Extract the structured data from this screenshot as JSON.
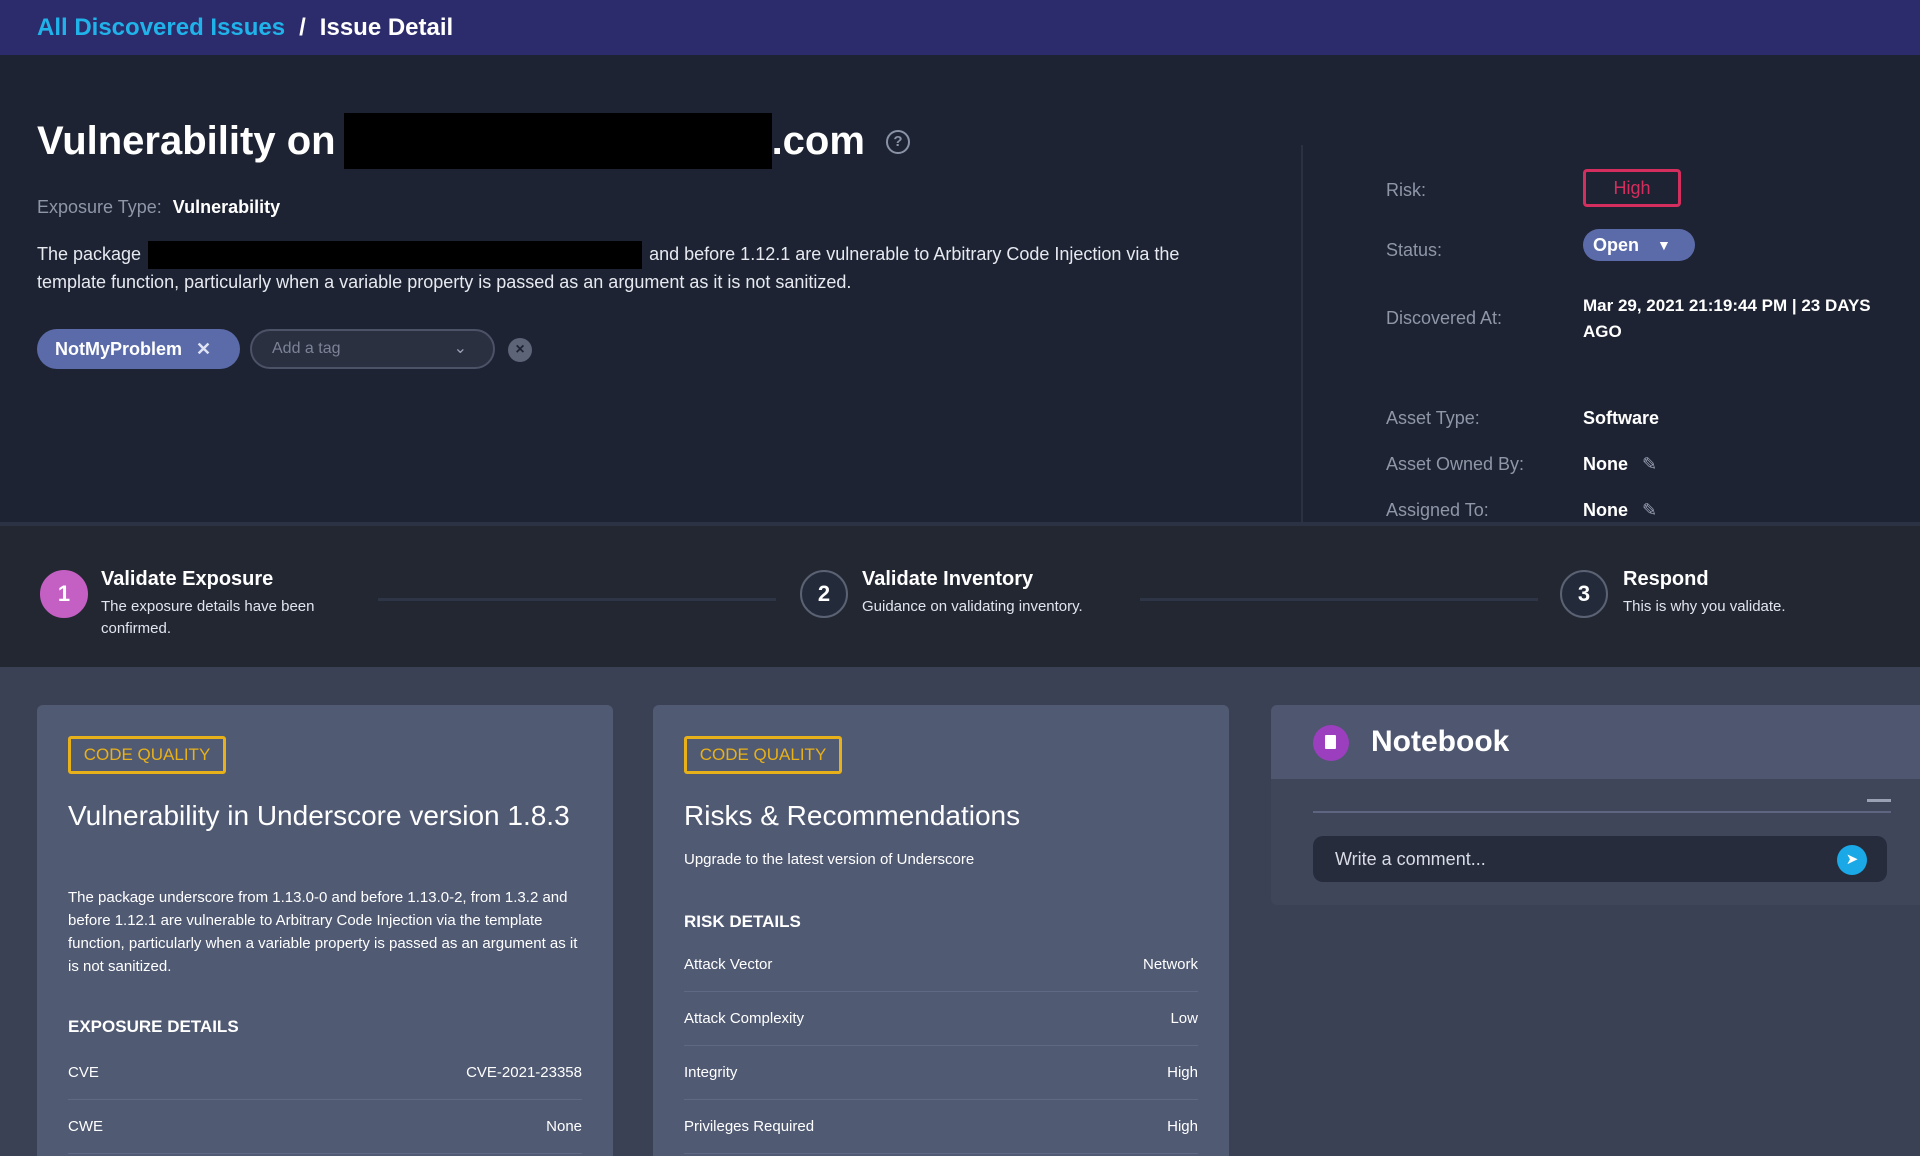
{
  "breadcrumb": {
    "link": "All Discovered Issues",
    "separator": "/",
    "current": "Issue Detail"
  },
  "header": {
    "title_prefix": "Vulnerability on",
    "title_suffix": ".com",
    "exposure_type_label": "Exposure Type:",
    "exposure_type_value": "Vulnerability",
    "description_start": "The package",
    "description_end": "and before 1.12.1 are vulnerable to Arbitrary Code Injection via the template function, particularly when a variable property is passed as an argument as it is not sanitized.",
    "tags": [
      {
        "label": "NotMyProblem"
      }
    ],
    "tag_placeholder": "Add a tag"
  },
  "meta": {
    "risk_label": "Risk:",
    "risk_value": "High",
    "status_label": "Status:",
    "status_value": "Open",
    "discovered_label": "Discovered At:",
    "discovered_value": "Mar 29, 2021 21:19:44 PM | 23 DAYS AGO",
    "asset_type_label": "Asset Type:",
    "asset_type_value": "Software",
    "asset_owned_label": "Asset Owned By:",
    "asset_owned_value": "None",
    "assigned_label": "Assigned To:",
    "assigned_value": "None"
  },
  "steps": [
    {
      "number": "1",
      "title": "Validate Exposure",
      "subtitle": "The exposure details have been confirmed.",
      "active": true
    },
    {
      "number": "2",
      "title": "Validate Inventory",
      "subtitle": "Guidance on validating inventory.",
      "active": false
    },
    {
      "number": "3",
      "title": "Respond",
      "subtitle": "This is why you validate.",
      "active": false
    }
  ],
  "card1": {
    "badge": "CODE QUALITY",
    "title": "Vulnerability in Underscore version 1.8.3",
    "body": "The package underscore from 1.13.0-0 and before 1.13.0-2, from 1.3.2 and before 1.12.1 are vulnerable to Arbitrary Code Injection via the template function, particularly when a variable property is passed as an argument as it is not sanitized.",
    "section": "EXPOSURE DETAILS",
    "rows": [
      {
        "key": "CVE",
        "value": "CVE-2021-23358"
      },
      {
        "key": "CWE",
        "value": "None"
      }
    ]
  },
  "card2": {
    "badge": "CODE QUALITY",
    "title": "Risks & Recommendations",
    "body": "Upgrade to the latest version of Underscore",
    "section": "RISK DETAILS",
    "rows": [
      {
        "key": "Attack Vector",
        "value": "Network"
      },
      {
        "key": "Attack Complexity",
        "value": "Low"
      },
      {
        "key": "Integrity",
        "value": "High"
      },
      {
        "key": "Privileges Required",
        "value": "High"
      }
    ]
  },
  "notebook": {
    "title": "Notebook",
    "comment_placeholder": "Write a comment..."
  },
  "colors": {
    "topbar": "#2c2b6b",
    "link": "#20b3ea",
    "risk_high": "#d42e5e",
    "code_quality": "#e8b019",
    "step_active": "#c45fc3",
    "send_button": "#1aa8e6"
  }
}
